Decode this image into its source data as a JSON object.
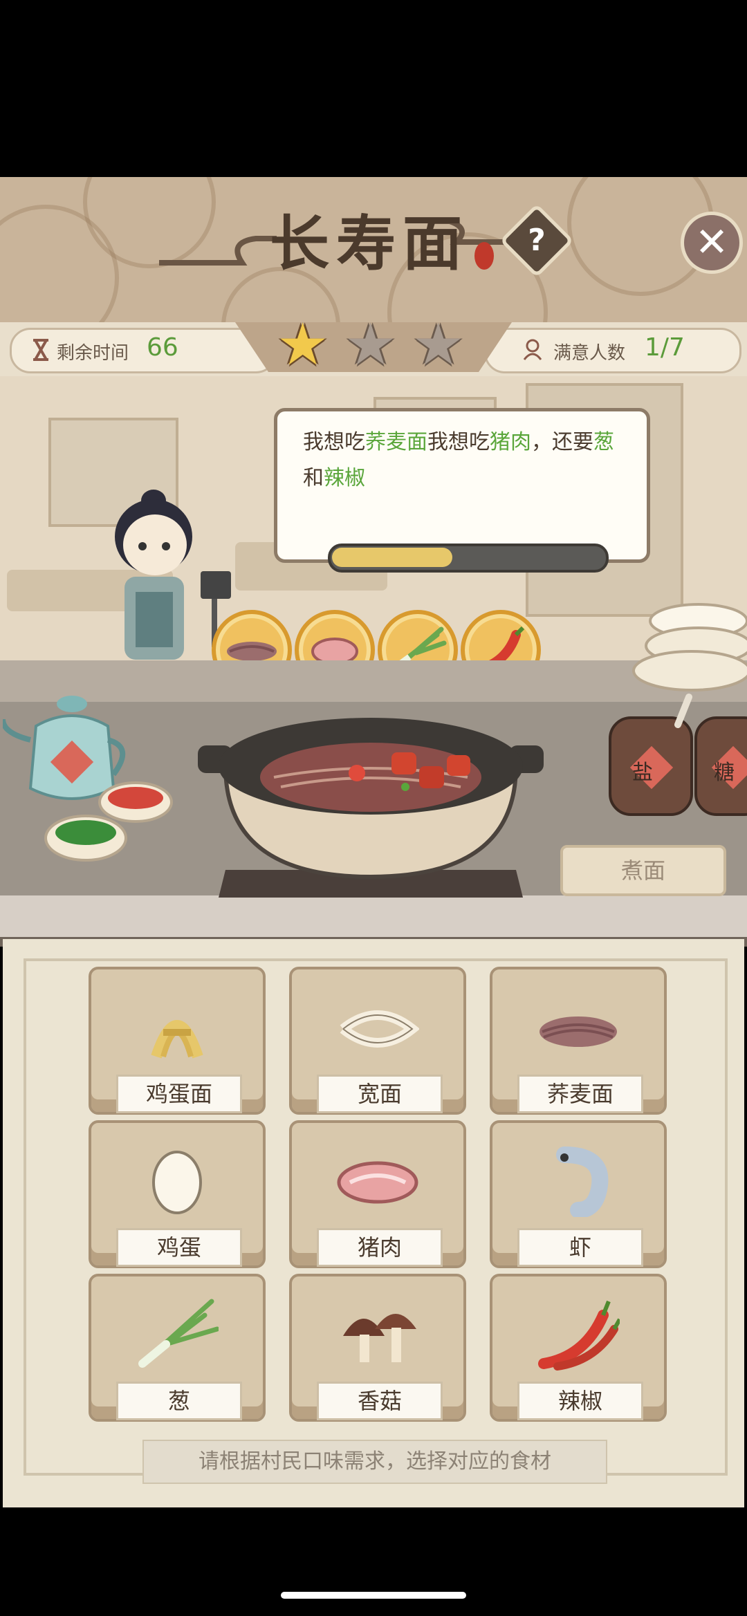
{
  "header": {
    "title": "长寿面",
    "help": "?",
    "close": "✕"
  },
  "status": {
    "time_label": "剩余时间",
    "time_value": "66",
    "satisfied_label": "满意人数",
    "satisfied_value": "1/7",
    "stars_earned": 1,
    "stars_total": 3
  },
  "speech": {
    "p1": "我想吃",
    "item1": "荞麦面",
    "p2": "我想吃",
    "item2": "猪肉",
    "p3": "，还要",
    "item3": "葱",
    "p4": "和",
    "item4": "辣椒",
    "patience": 0.45
  },
  "jars": {
    "salt": "盐",
    "sugar": "糖"
  },
  "cook_button": "煮面",
  "ingredients": [
    {
      "label": "鸡蛋面"
    },
    {
      "label": "宽面"
    },
    {
      "label": "荞麦面"
    },
    {
      "label": "鸡蛋"
    },
    {
      "label": "猪肉"
    },
    {
      "label": "虾"
    },
    {
      "label": "葱"
    },
    {
      "label": "香菇"
    },
    {
      "label": "辣椒"
    }
  ],
  "hint": "请根据村民口味需求，选择对应的食材",
  "colors": {
    "highlight": "#5aa63b",
    "star_on": "#f2c94c",
    "star_off": "#a89b90"
  }
}
